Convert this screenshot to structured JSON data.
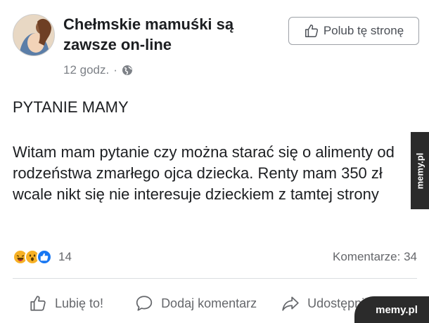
{
  "post": {
    "page_name": "Chełmskie mamuśki są zawsze on-line",
    "time": "12 godz.",
    "separator": "·",
    "like_page_label": "Polub tę stronę",
    "title": "PYTANIE MAMY",
    "body": "Witam mam pytanie czy można starać się o alimenty od rodzeństwa zmarłego ojca dziecka. Renty mam 350 zł wcale nikt się nie interesuje dzieckiem z tamtej strony"
  },
  "stats": {
    "reaction_icons": [
      "haha-icon",
      "wow-icon",
      "like-icon"
    ],
    "reaction_count": "14",
    "comments": "Komentarze: 34"
  },
  "actions": {
    "like": "Lubię to!",
    "comment": "Dodaj komentarz",
    "share": "Udostępnij"
  },
  "watermarks": {
    "side": "memy.pl",
    "corner": "memy.pl"
  },
  "colors": {
    "text": "#1c1e21",
    "muted": "#65676b",
    "reaction_like": "#1877f2",
    "reaction_emoji": "#f7b125",
    "watermark_bg": "#2b2b2b"
  }
}
